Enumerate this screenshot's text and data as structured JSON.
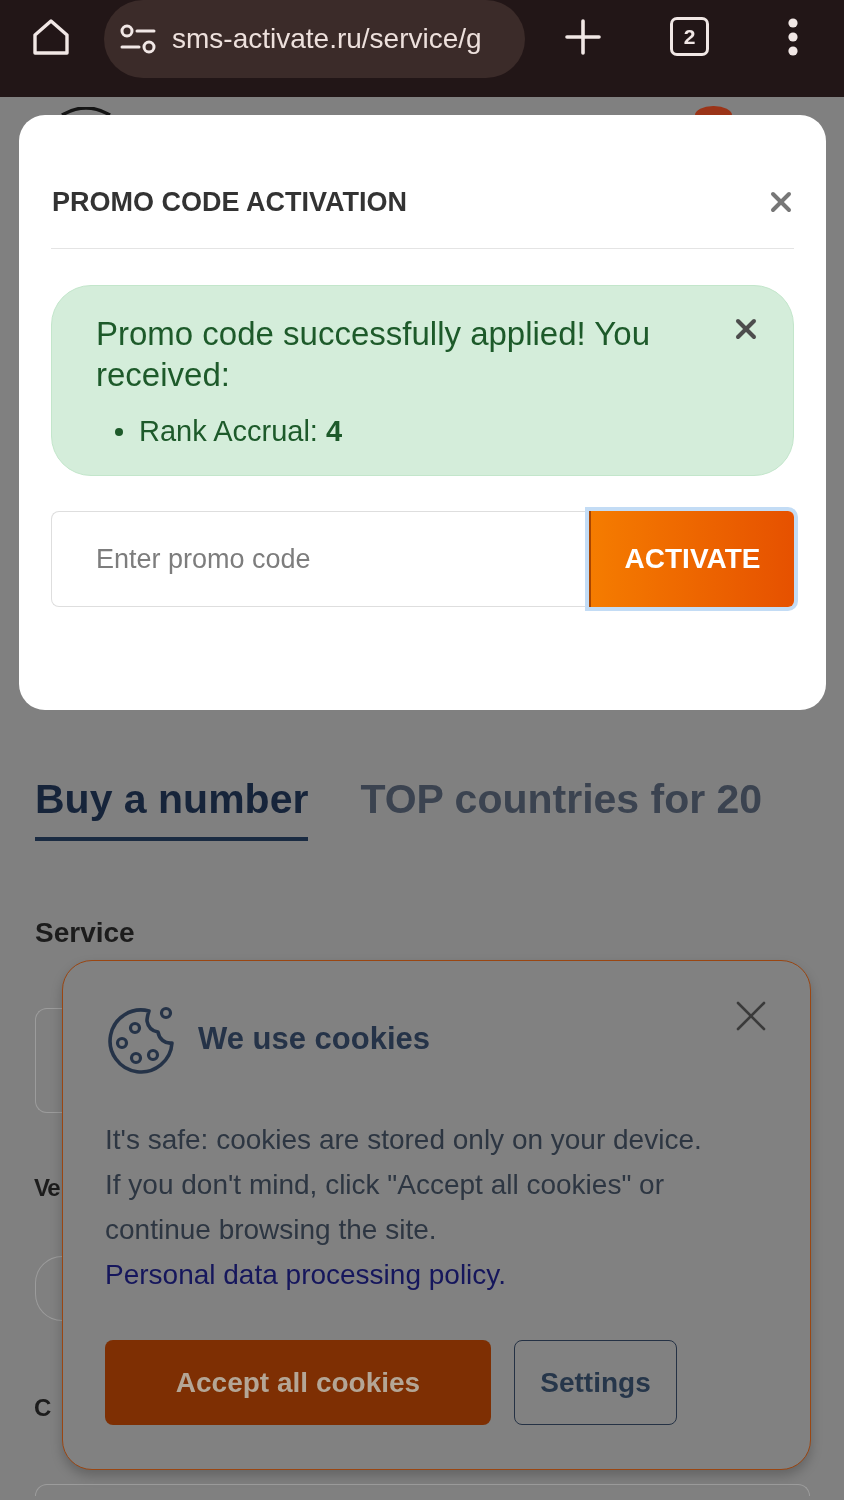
{
  "browser": {
    "url": "sms-activate.ru/service/g",
    "tab_count": "2"
  },
  "page": {
    "tabs": [
      {
        "label": "Buy a number",
        "selected": true
      },
      {
        "label": "TOP countries for 20",
        "selected": false
      }
    ],
    "fields": [
      {
        "label": "Service",
        "kind": "select"
      },
      {
        "label": "Ve",
        "kind": "round"
      },
      {
        "label": "C",
        "kind": "bar"
      }
    ]
  },
  "promo_modal": {
    "title": "PROMO CODE ACTIVATION",
    "alert": {
      "message": "Promo code successfully applied! You received:",
      "items": [
        "Rank Accrual: **4**"
      ]
    },
    "input": {
      "placeholder": "Enter promo code"
    },
    "button": "ACTIVATE"
  },
  "cookie_banner": {
    "title": "We use cookies",
    "text": "It's safe: cookies are stored only on your device. If you don't mind, click \"Accept all cookies\" or continue browsing the site.",
    "link": "Personal data processing policy.",
    "buttons": [
      {
        "label": "Accept all cookies",
        "kind": "primary"
      },
      {
        "label": "Settings",
        "kind": "secondary"
      }
    ]
  }
}
